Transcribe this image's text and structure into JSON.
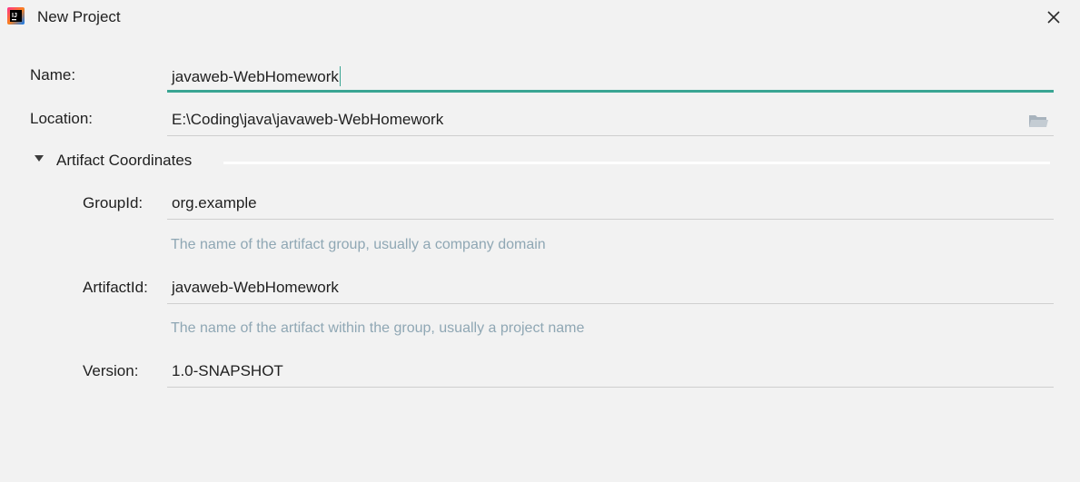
{
  "window": {
    "title": "New Project",
    "app_icon": "intellij-idea-icon",
    "close_icon": "close-icon"
  },
  "form": {
    "name": {
      "label": "Name:",
      "value": "javaweb-WebHomework"
    },
    "location": {
      "label": "Location:",
      "value": "E:\\Coding\\java\\javaweb-WebHomework",
      "icon": "folder-icon"
    },
    "artifact_section": {
      "title": "Artifact Coordinates",
      "expanded": true,
      "group_id": {
        "label": "GroupId:",
        "value": "org.example",
        "hint": "The name of the artifact group, usually a company domain"
      },
      "artifact_id": {
        "label": "ArtifactId:",
        "value": "javaweb-WebHomework",
        "hint": "The name of the artifact within the group, usually a project name"
      },
      "version": {
        "label": "Version:",
        "value": "1.0-SNAPSHOT"
      }
    }
  },
  "colors": {
    "background": "#f2f2f2",
    "focus_accent": "#3aa593",
    "hint_text": "#8fa7b4",
    "field_underline": "#cfcfcf"
  }
}
